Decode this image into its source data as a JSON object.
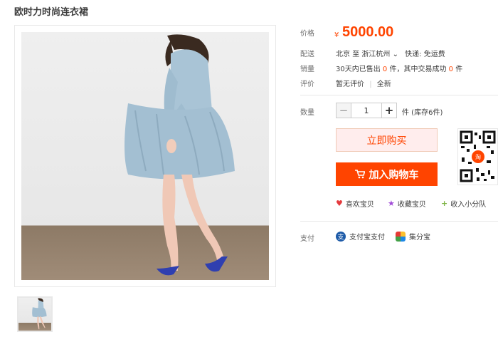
{
  "product": {
    "title": "欧时力时尚连衣裙"
  },
  "price": {
    "label": "价格",
    "currency": "¥",
    "amount": "5000.00"
  },
  "shipping": {
    "label": "配送",
    "from": "北京",
    "to_word": "至",
    "to": "浙江杭州",
    "dropdown": "⌄",
    "fee": "快递: 免运费"
  },
  "sales": {
    "label": "销量",
    "prefix": "30天内已售出",
    "sold": "0",
    "mid": "件，其中交易成功",
    "success": "0",
    "suffix": "件"
  },
  "review": {
    "label": "评价",
    "none": "暂无评价",
    "divider": "|",
    "status": "全新"
  },
  "quantity": {
    "label": "数量",
    "minus": "−",
    "value": "1",
    "plus": "+",
    "stock": "件 (库存6件)"
  },
  "buttons": {
    "buy_now": "立即购买",
    "add_to_cart": "加入购物车"
  },
  "actions": {
    "like": "喜欢宝贝",
    "favorite": "收藏宝贝",
    "add_to_album": "收入小分队"
  },
  "payment": {
    "label": "支付",
    "alipay": "支付宝支付",
    "jifenbao": "集分宝"
  },
  "colors": {
    "accent": "#ff4400",
    "buy_bg": "#ffeded",
    "text": "#3c3c3c",
    "muted": "#6c6c6c"
  },
  "icons": {
    "heart": "heart-icon",
    "star": "star-icon",
    "plus": "plus-icon",
    "cart": "cart-icon",
    "alipay": "alipay-icon",
    "jifenbao": "jifenbao-icon",
    "qr": "qr-code"
  }
}
